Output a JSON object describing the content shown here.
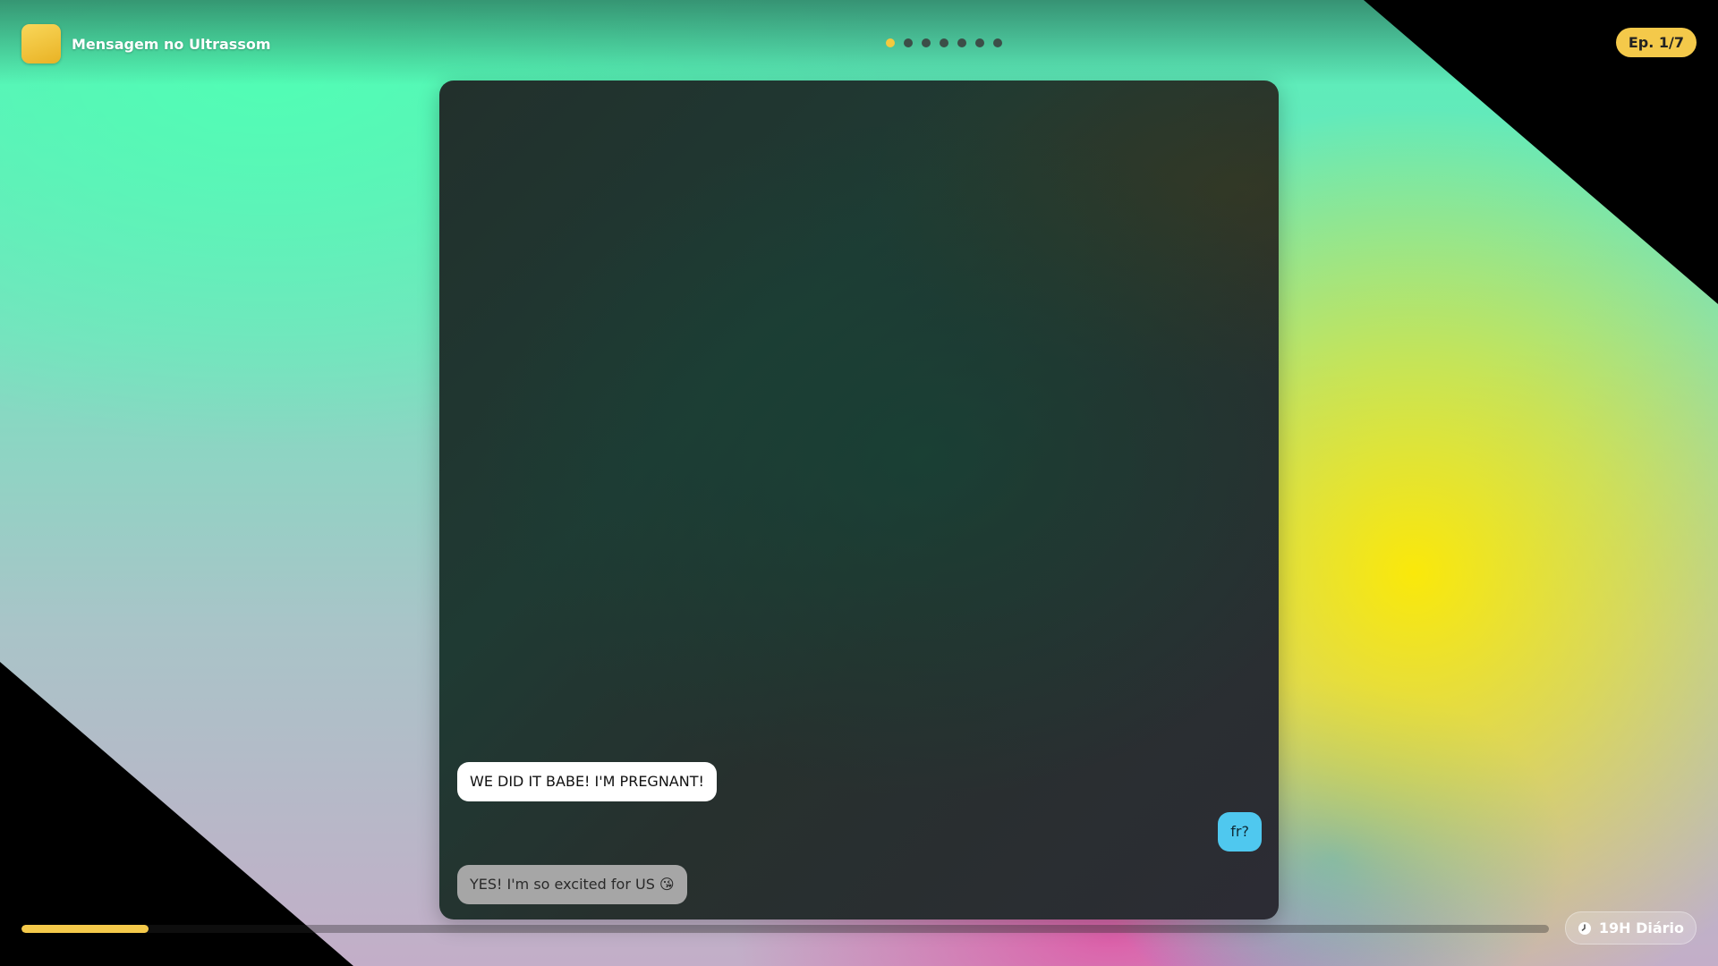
{
  "header": {
    "title": "Mensagem no Ultrassom",
    "episode_badge": "Ep. 1/7",
    "pagination": {
      "total": 7,
      "active_index": 0
    }
  },
  "chat": {
    "messages": [
      {
        "side": "left",
        "text": "WE DID IT BABE! I'M PREGNANT!"
      },
      {
        "side": "right",
        "text": "fr?"
      },
      {
        "side": "left",
        "text": "YES! I'm so excited for US 😘"
      }
    ]
  },
  "footer": {
    "progress_fraction": 0.083,
    "timer_label": "19H Diário",
    "timer_icon": "clock-icon"
  },
  "colors": {
    "accent": "#f4c94a",
    "bubble_incoming": "#ffffff",
    "bubble_outgoing": "#4fc8ef",
    "bubble_typing": "#a6a6a6"
  }
}
